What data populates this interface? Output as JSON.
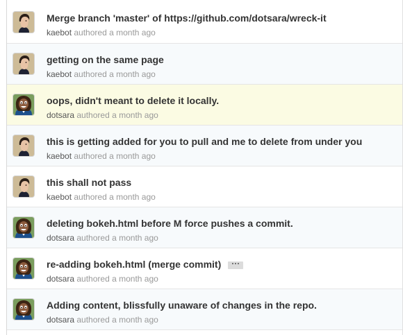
{
  "commits": [
    {
      "title": "Merge branch 'master' of https://github.com/dotsara/wreck-it",
      "author": "kaebot",
      "verb": "authored",
      "time": "a month ago",
      "avatar": "kaebot-avatar"
    },
    {
      "title": "getting on the same page",
      "author": "kaebot",
      "verb": "authored",
      "time": "a month ago",
      "avatar": "kaebot-avatar"
    },
    {
      "title": "oops, didn't meant to delete it locally.",
      "author": "dotsara",
      "verb": "authored",
      "time": "a month ago",
      "avatar": "dotsara-avatar"
    },
    {
      "title": "this is getting added for you to pull and me to delete from under you",
      "author": "kaebot",
      "verb": "authored",
      "time": "a month ago",
      "avatar": "kaebot-avatar"
    },
    {
      "title": "this shall not pass",
      "author": "kaebot",
      "verb": "authored",
      "time": "a month ago",
      "avatar": "kaebot-avatar"
    },
    {
      "title": "deleting bokeh.html before M force pushes a commit.",
      "author": "dotsara",
      "verb": "authored",
      "time": "a month ago",
      "avatar": "dotsara-avatar"
    },
    {
      "title": "re-adding bokeh.html (merge commit)",
      "author": "dotsara",
      "verb": "authored",
      "time": "a month ago",
      "avatar": "dotsara-avatar",
      "expander": "···"
    },
    {
      "title": "Adding content, blissfully unaware of changes in the repo.",
      "author": "dotsara",
      "verb": "authored",
      "time": "a month ago",
      "avatar": "dotsara-avatar"
    }
  ],
  "colors": {
    "title": "#333333",
    "meta": "#999999",
    "highlight_row": "#fbfbe3",
    "alt_row": "#f7fafc"
  }
}
